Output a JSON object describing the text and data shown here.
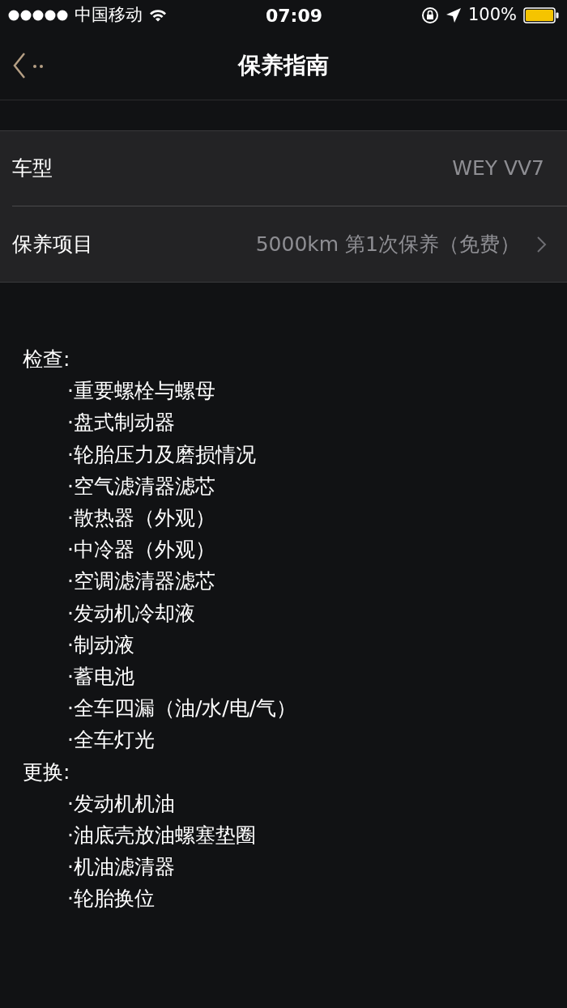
{
  "status_bar": {
    "carrier": "中国移动",
    "time": "07:09",
    "battery": "100%"
  },
  "nav": {
    "title": "保养指南"
  },
  "rows": [
    {
      "label": "车型",
      "value": "WEY VV7",
      "kind": "static"
    },
    {
      "label": "保养项目",
      "value": "5000km 第1次保养（免费）",
      "kind": "link"
    }
  ],
  "sections": [
    {
      "heading": "检查:",
      "items": [
        "·重要螺栓与螺母",
        "·盘式制动器",
        "·轮胎压力及磨损情况",
        "·空气滤清器滤芯",
        "·散热器（外观）",
        "·中冷器（外观）",
        "·空调滤清器滤芯",
        "·发动机冷却液",
        "·制动液",
        "·蓄电池",
        "·全车四漏（油/水/电/气）",
        "·全车灯光"
      ]
    },
    {
      "heading": "更换:",
      "items": [
        "·发动机机油",
        "·油底壳放油螺塞垫圈",
        "·机油滤清器",
        "·轮胎换位"
      ]
    }
  ]
}
